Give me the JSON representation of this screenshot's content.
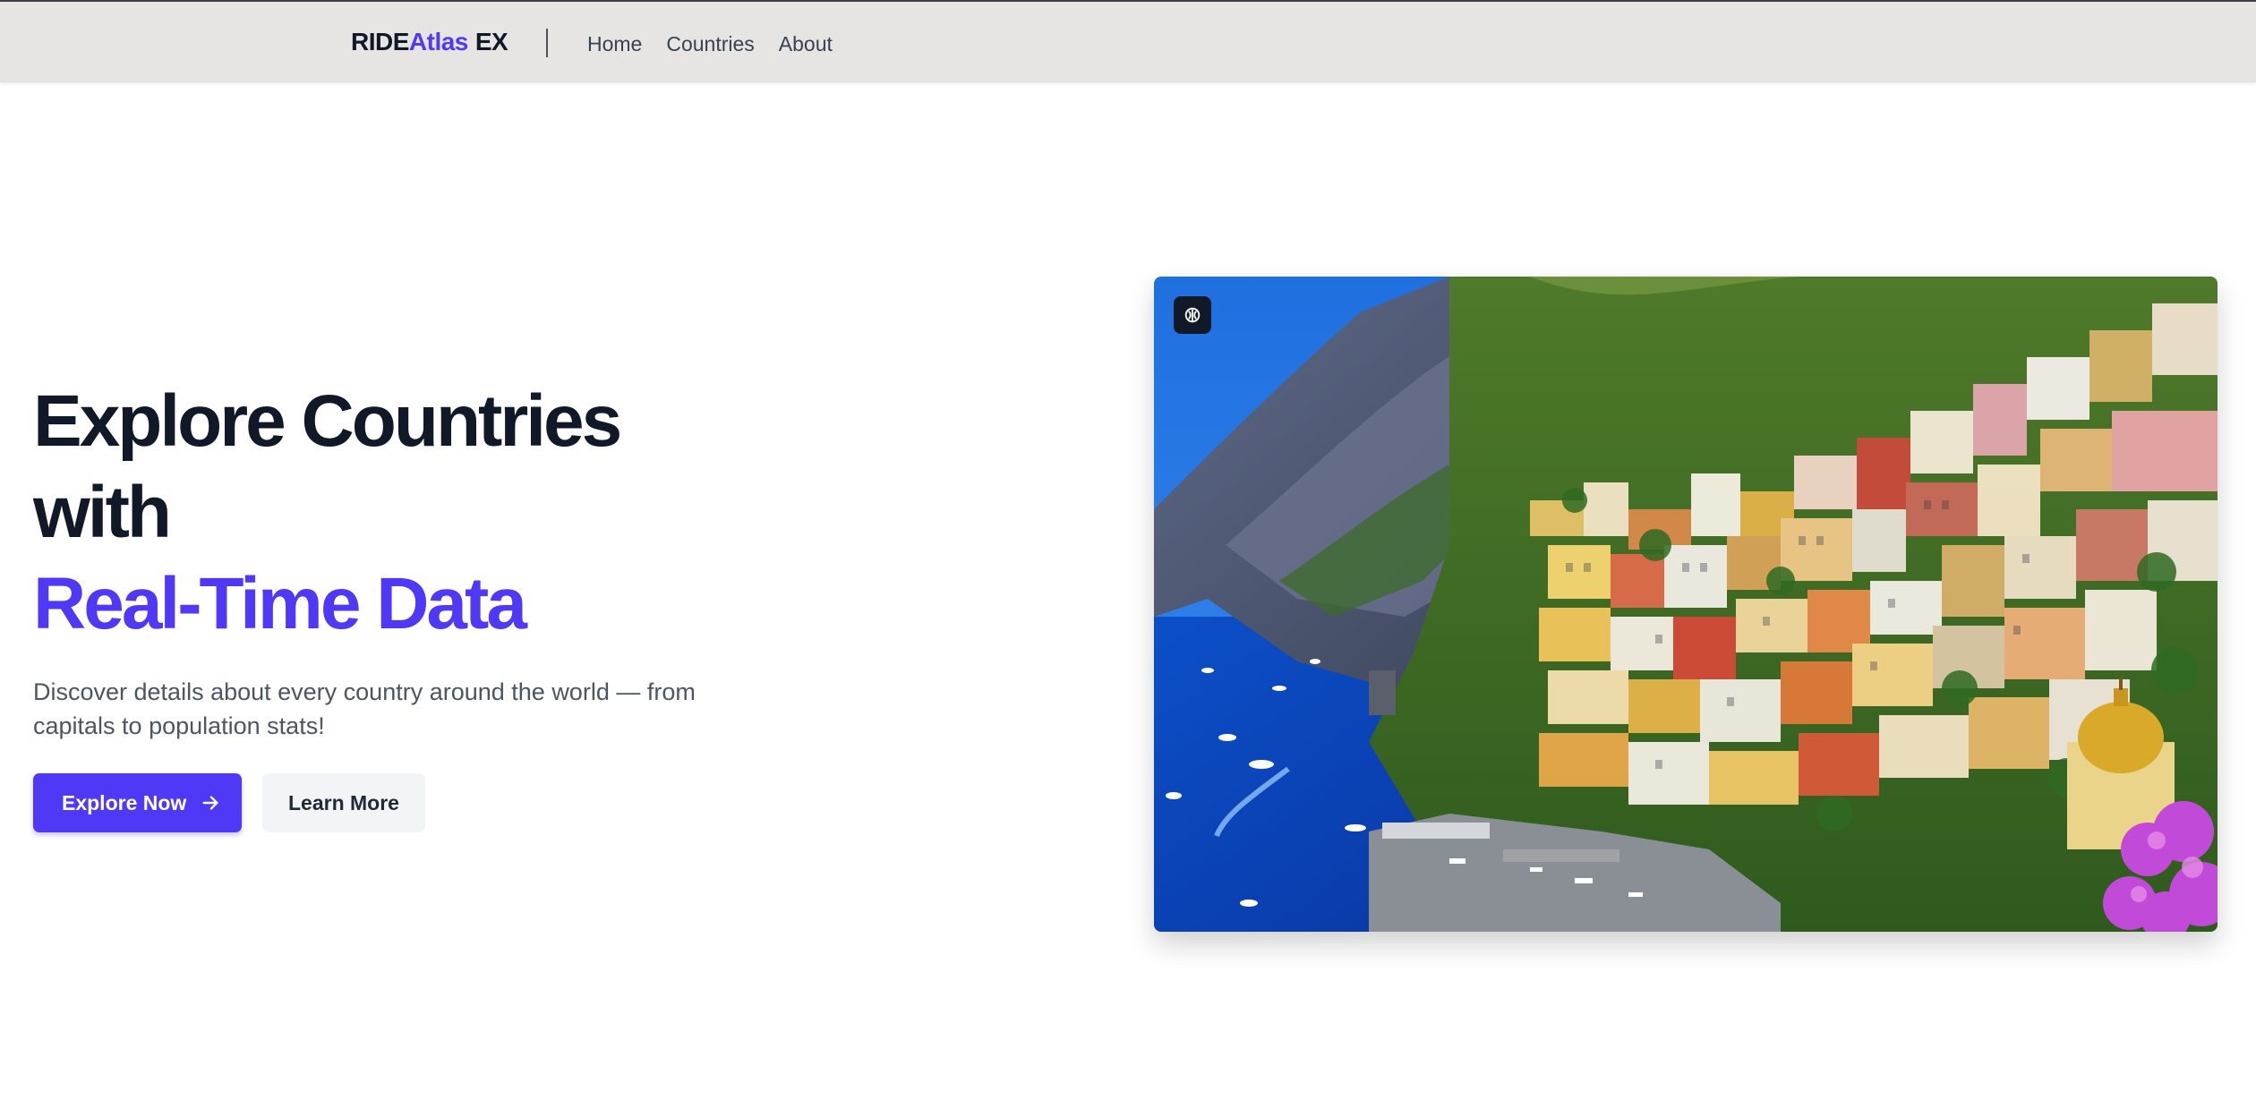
{
  "brand": {
    "part1": "RIDE",
    "part2": "Atlas",
    "part3": "EX"
  },
  "nav": {
    "items": [
      {
        "label": "Home"
      },
      {
        "label": "Countries"
      },
      {
        "label": "About"
      }
    ]
  },
  "hero": {
    "title_line1": "Explore Countries",
    "title_line2": "with",
    "title_line3": "Real-Time Data",
    "description": "Discover details about every country around the world — from capitals to population stats!",
    "primary_button": "Explore Now",
    "secondary_button": "Learn More",
    "image_alt": "Colorful cliffside town above a blue sea",
    "badge_icon": "brain-icon"
  },
  "colors": {
    "accent": "#4f39f6",
    "navbar_bg": "#e7e5e4",
    "text_dark": "#111827",
    "text_muted": "#4b5563"
  }
}
